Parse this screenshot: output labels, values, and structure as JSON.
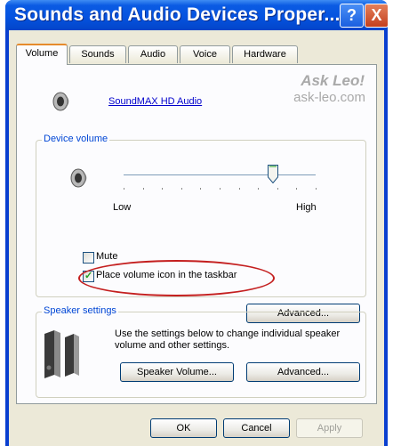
{
  "window": {
    "title": "Sounds and Audio Devices Proper..."
  },
  "titlebar_buttons": {
    "help": "?",
    "close": "X"
  },
  "tabs": [
    {
      "label": "Volume",
      "active": true
    },
    {
      "label": "Sounds",
      "active": false
    },
    {
      "label": "Audio",
      "active": false
    },
    {
      "label": "Voice",
      "active": false
    },
    {
      "label": "Hardware",
      "active": false
    }
  ],
  "device": {
    "name": "SoundMAX HD Audio"
  },
  "watermark": {
    "line1": "Ask Leo!",
    "line2": "ask-leo.com"
  },
  "device_volume": {
    "legend": "Device volume",
    "low_label": "Low",
    "high_label": "High",
    "level": 0.78,
    "mute_label": "Mute",
    "mute_checked": false,
    "taskbar_label": "Place volume icon in the taskbar",
    "taskbar_checked": true,
    "advanced_label": "Advanced..."
  },
  "speaker_settings": {
    "legend": "Speaker settings",
    "description": "Use the settings below to change individual speaker volume and other settings.",
    "speaker_volume_label": "Speaker Volume...",
    "advanced_label": "Advanced..."
  },
  "footer": {
    "ok": "OK",
    "cancel": "Cancel",
    "apply": "Apply"
  },
  "colors": {
    "titlebar": "#0553e0",
    "tab_accent": "#e68b2c",
    "legend_text": "#0046d5",
    "highlight_ring": "#c41f1f",
    "checkmark": "#21a121"
  }
}
